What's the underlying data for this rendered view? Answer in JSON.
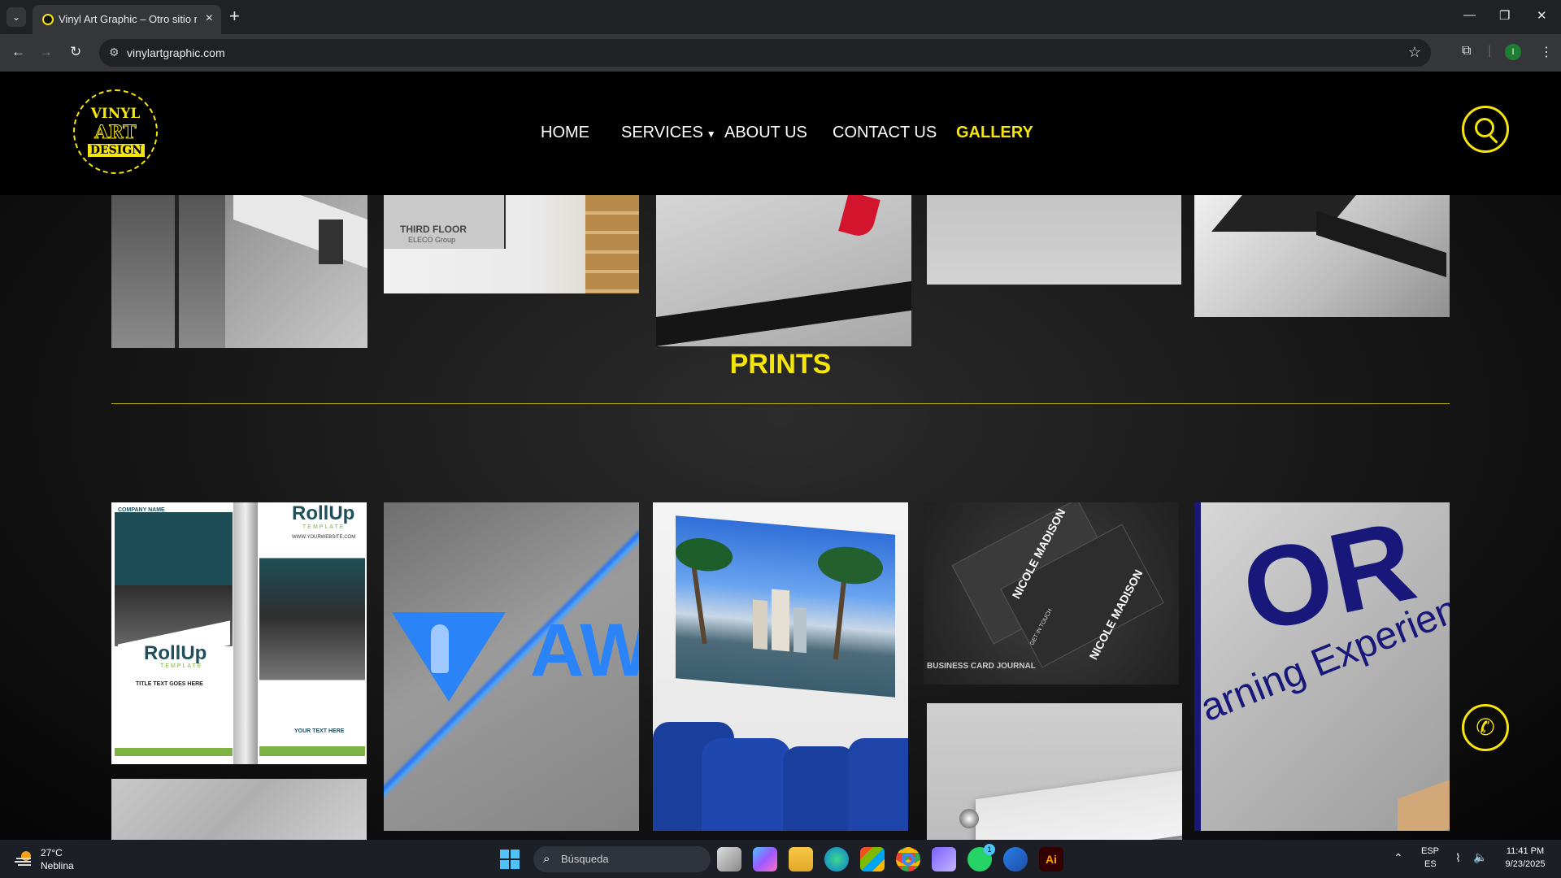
{
  "browser": {
    "tab_title": "Vinyl Art Graphic – Otro sitio re",
    "url": "vinylartgraphic.com"
  },
  "site": {
    "logo": {
      "line1": "VINYL",
      "line2": "ART",
      "line3": "DESIGN"
    },
    "nav": {
      "home": "HOME",
      "services": "SERVICES",
      "about": "ABOUT US",
      "contact": "CONTACT US",
      "gallery": "GALLERY"
    },
    "section_title": "PRINTS",
    "accent_color": "#f5e50a",
    "photos_top": [
      {
        "name": "wall-mount-sign-photo"
      },
      {
        "name": "third-floor-sign-photo",
        "text": "THIRD FLOOR",
        "subtext": "ELECO Group"
      },
      {
        "name": "aluminum-panel-photo"
      },
      {
        "name": "white-panel-photo"
      },
      {
        "name": "dimensional-letter-photo"
      }
    ],
    "photos_prints": [
      {
        "name": "rollup-banner-photo",
        "company": "COMPANY NAME",
        "heading": "RollUp",
        "sub": "TEMPLATE",
        "website": "WWW.YOURWEBSITE.COM",
        "title_text": "TITLE TEXT GOES HERE",
        "your_text": "YOUR TEXT HERE"
      },
      {
        "name": "aw-logo-sign-photo",
        "text": "AW"
      },
      {
        "name": "miami-wall-print-photo"
      },
      {
        "name": "business-cards-photo",
        "name_text": "NICOLE MADISON",
        "cta": "GET IN TOUCH",
        "watermark": "BUSINESS CARD JOURNAL"
      },
      {
        "name": "brushed-metal-print-photo",
        "text": "arning Experienc"
      },
      {
        "name": "texture-panel-photo"
      },
      {
        "name": "standoff-panel-photo"
      }
    ]
  },
  "taskbar": {
    "temp": "27°C",
    "weather": "Neblina",
    "search_placeholder": "Búsqueda",
    "lang1": "ESP",
    "lang2": "ES",
    "time": "11:41 PM",
    "date": "9/23/2025",
    "whatsapp_badge": "1"
  }
}
